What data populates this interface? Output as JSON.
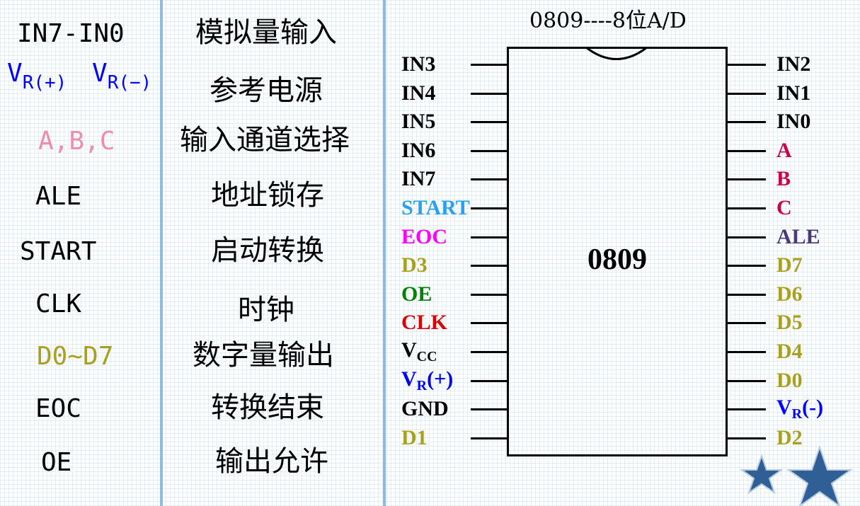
{
  "signals": [
    {
      "id": "in",
      "label": "IN7-IN0",
      "color": "#000000",
      "desc": "模拟量输入"
    },
    {
      "id": "vr",
      "vr1": "V",
      "vr1_sub": "R(+)",
      "vr2": "V",
      "vr2_sub": "R(−)",
      "color": "#0000ff",
      "desc": "参考电源"
    },
    {
      "id": "abc",
      "label": "A,B,C",
      "color": "#f08ca8",
      "desc": "输入通道选择"
    },
    {
      "id": "ale",
      "label": "ALE",
      "color": "#000000",
      "desc": "地址锁存"
    },
    {
      "id": "start",
      "label": "START",
      "color": "#000000",
      "desc": "启动转换"
    },
    {
      "id": "clk",
      "label": "CLK",
      "color": "#000000",
      "desc": "时钟"
    },
    {
      "id": "d",
      "label": "D0~D7",
      "color": "#a8a020",
      "desc": "数字量输出"
    },
    {
      "id": "eoc",
      "label": "EOC",
      "color": "#000000",
      "desc": "转换结束"
    },
    {
      "id": "oe",
      "label": "OE",
      "color": "#000000",
      "desc": "输出允许"
    }
  ],
  "chip": {
    "title": "0809----8位A/D",
    "name": "0809",
    "left_pins": [
      {
        "label": "IN3",
        "color": "#000000"
      },
      {
        "label": "IN4",
        "color": "#000000"
      },
      {
        "label": "IN5",
        "color": "#000000"
      },
      {
        "label": "IN6",
        "color": "#000000"
      },
      {
        "label": "IN7",
        "color": "#000000"
      },
      {
        "label": "START",
        "color": "#2aa0f0"
      },
      {
        "label": "EOC",
        "color": "#ff00ff"
      },
      {
        "label": "D3",
        "color": "#a8a020"
      },
      {
        "label": "OE",
        "color": "#008000"
      },
      {
        "label": "CLK",
        "color": "#dd0000"
      },
      {
        "label": "V",
        "sub": "CC",
        "color": "#000000"
      },
      {
        "label": "V",
        "sub": "R",
        "suffix": "(+)",
        "color": "#0000ff"
      },
      {
        "label": "GND",
        "color": "#000000"
      },
      {
        "label": "D1",
        "color": "#a8a020"
      }
    ],
    "right_pins": [
      {
        "label": "IN2",
        "color": "#000000"
      },
      {
        "label": "IN1",
        "color": "#000000"
      },
      {
        "label": "IN0",
        "color": "#000000"
      },
      {
        "label": "A",
        "color": "#cc0044"
      },
      {
        "label": "B",
        "color": "#cc0044"
      },
      {
        "label": "C",
        "color": "#cc0044"
      },
      {
        "label": "ALE",
        "color": "#4a3a7a"
      },
      {
        "label": "D7",
        "color": "#a8a020"
      },
      {
        "label": "D6",
        "color": "#a8a020"
      },
      {
        "label": "D5",
        "color": "#a8a020"
      },
      {
        "label": "D4",
        "color": "#a8a020"
      },
      {
        "label": "D0",
        "color": "#a8a020"
      },
      {
        "label": "V",
        "sub": "R",
        "suffix": "(-)",
        "color": "#0000ff"
      },
      {
        "label": "D2",
        "color": "#a8a020"
      }
    ]
  },
  "decoration": {
    "icon": "star-icon",
    "star_color": "#2f5f95"
  }
}
